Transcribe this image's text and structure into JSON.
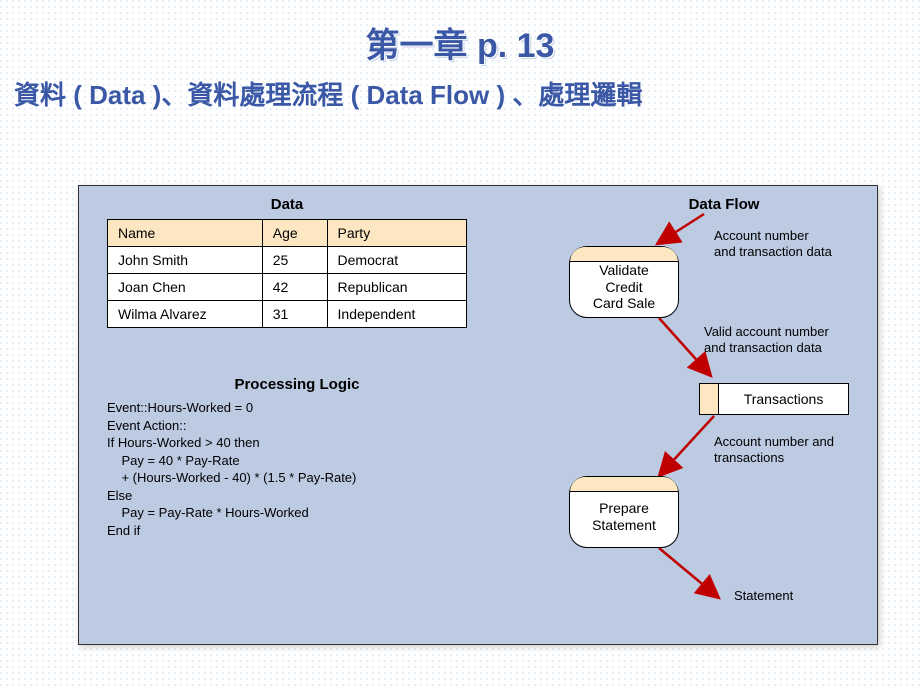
{
  "title": "第一章 p. 13",
  "subtitle": "資料 ( Data )、資料處理流程 ( Data Flow ) 、處理邏輯",
  "data_section": {
    "heading": "Data",
    "columns": [
      "Name",
      "Age",
      "Party"
    ],
    "rows": [
      [
        "John Smith",
        "25",
        "Democrat"
      ],
      [
        "Joan Chen",
        "42",
        "Republican"
      ],
      [
        "Wilma Alvarez",
        "31",
        "Independent"
      ]
    ]
  },
  "logic_section": {
    "heading": "Processing Logic",
    "code": "Event::Hours-Worked = 0\nEvent Action::\nIf Hours-Worked > 40 then\n    Pay = 40 * Pay-Rate\n    + (Hours-Worked - 40) * (1.5 * Pay-Rate)\nElse\n    Pay = Pay-Rate * Hours-Worked\nEnd if"
  },
  "flow_section": {
    "heading": "Data Flow",
    "nodes": {
      "validate": "Validate\nCredit\nCard Sale",
      "transactions": "Transactions",
      "prepare": "Prepare\nStatement"
    },
    "flows": {
      "in1": "Account number\nand transaction data",
      "mid": "Valid account number\nand transaction data",
      "in2": "Account number and\ntransactions",
      "out": "Statement"
    }
  }
}
